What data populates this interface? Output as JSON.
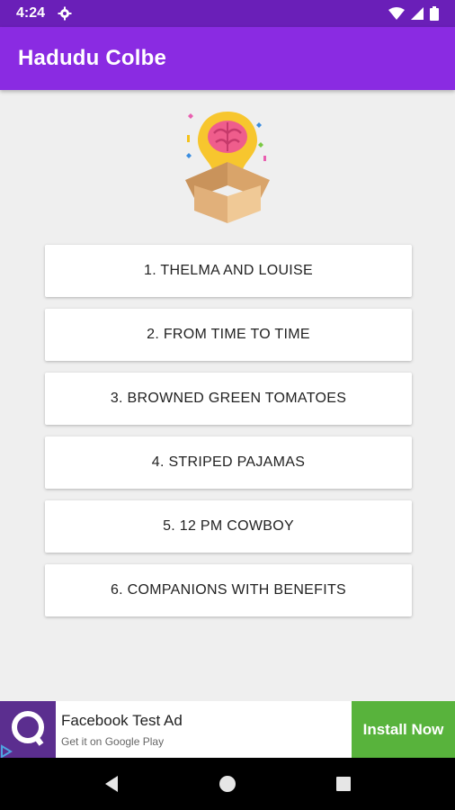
{
  "status_bar": {
    "time": "4:24",
    "icons": [
      "gear-icon",
      "wifi-icon",
      "signal-icon",
      "battery-icon"
    ]
  },
  "app_bar": {
    "title": "Hadudu Colbe"
  },
  "logo": {
    "icon": "lightbulb-brain-box-icon"
  },
  "menu": {
    "items": [
      {
        "label": "1. THELMA AND LOUISE"
      },
      {
        "label": "2. FROM TIME TO TIME"
      },
      {
        "label": "3. BROWNED GREEN TOMATOES"
      },
      {
        "label": "4. STRIPED PAJAMAS"
      },
      {
        "label": "5. 12 PM COWBOY"
      },
      {
        "label": "6. COMPANIONS WITH BENEFITS"
      }
    ]
  },
  "ad": {
    "title": "Facebook Test Ad",
    "subtitle": "Get it on Google Play",
    "cta": "Install Now",
    "cta_color": "#58b33c"
  },
  "nav_bar": {
    "icons": [
      "back-icon",
      "home-icon",
      "recents-icon"
    ]
  },
  "colors": {
    "status_bar": "#6a1fb8",
    "app_bar": "#8a2be2",
    "background": "#efefef"
  }
}
